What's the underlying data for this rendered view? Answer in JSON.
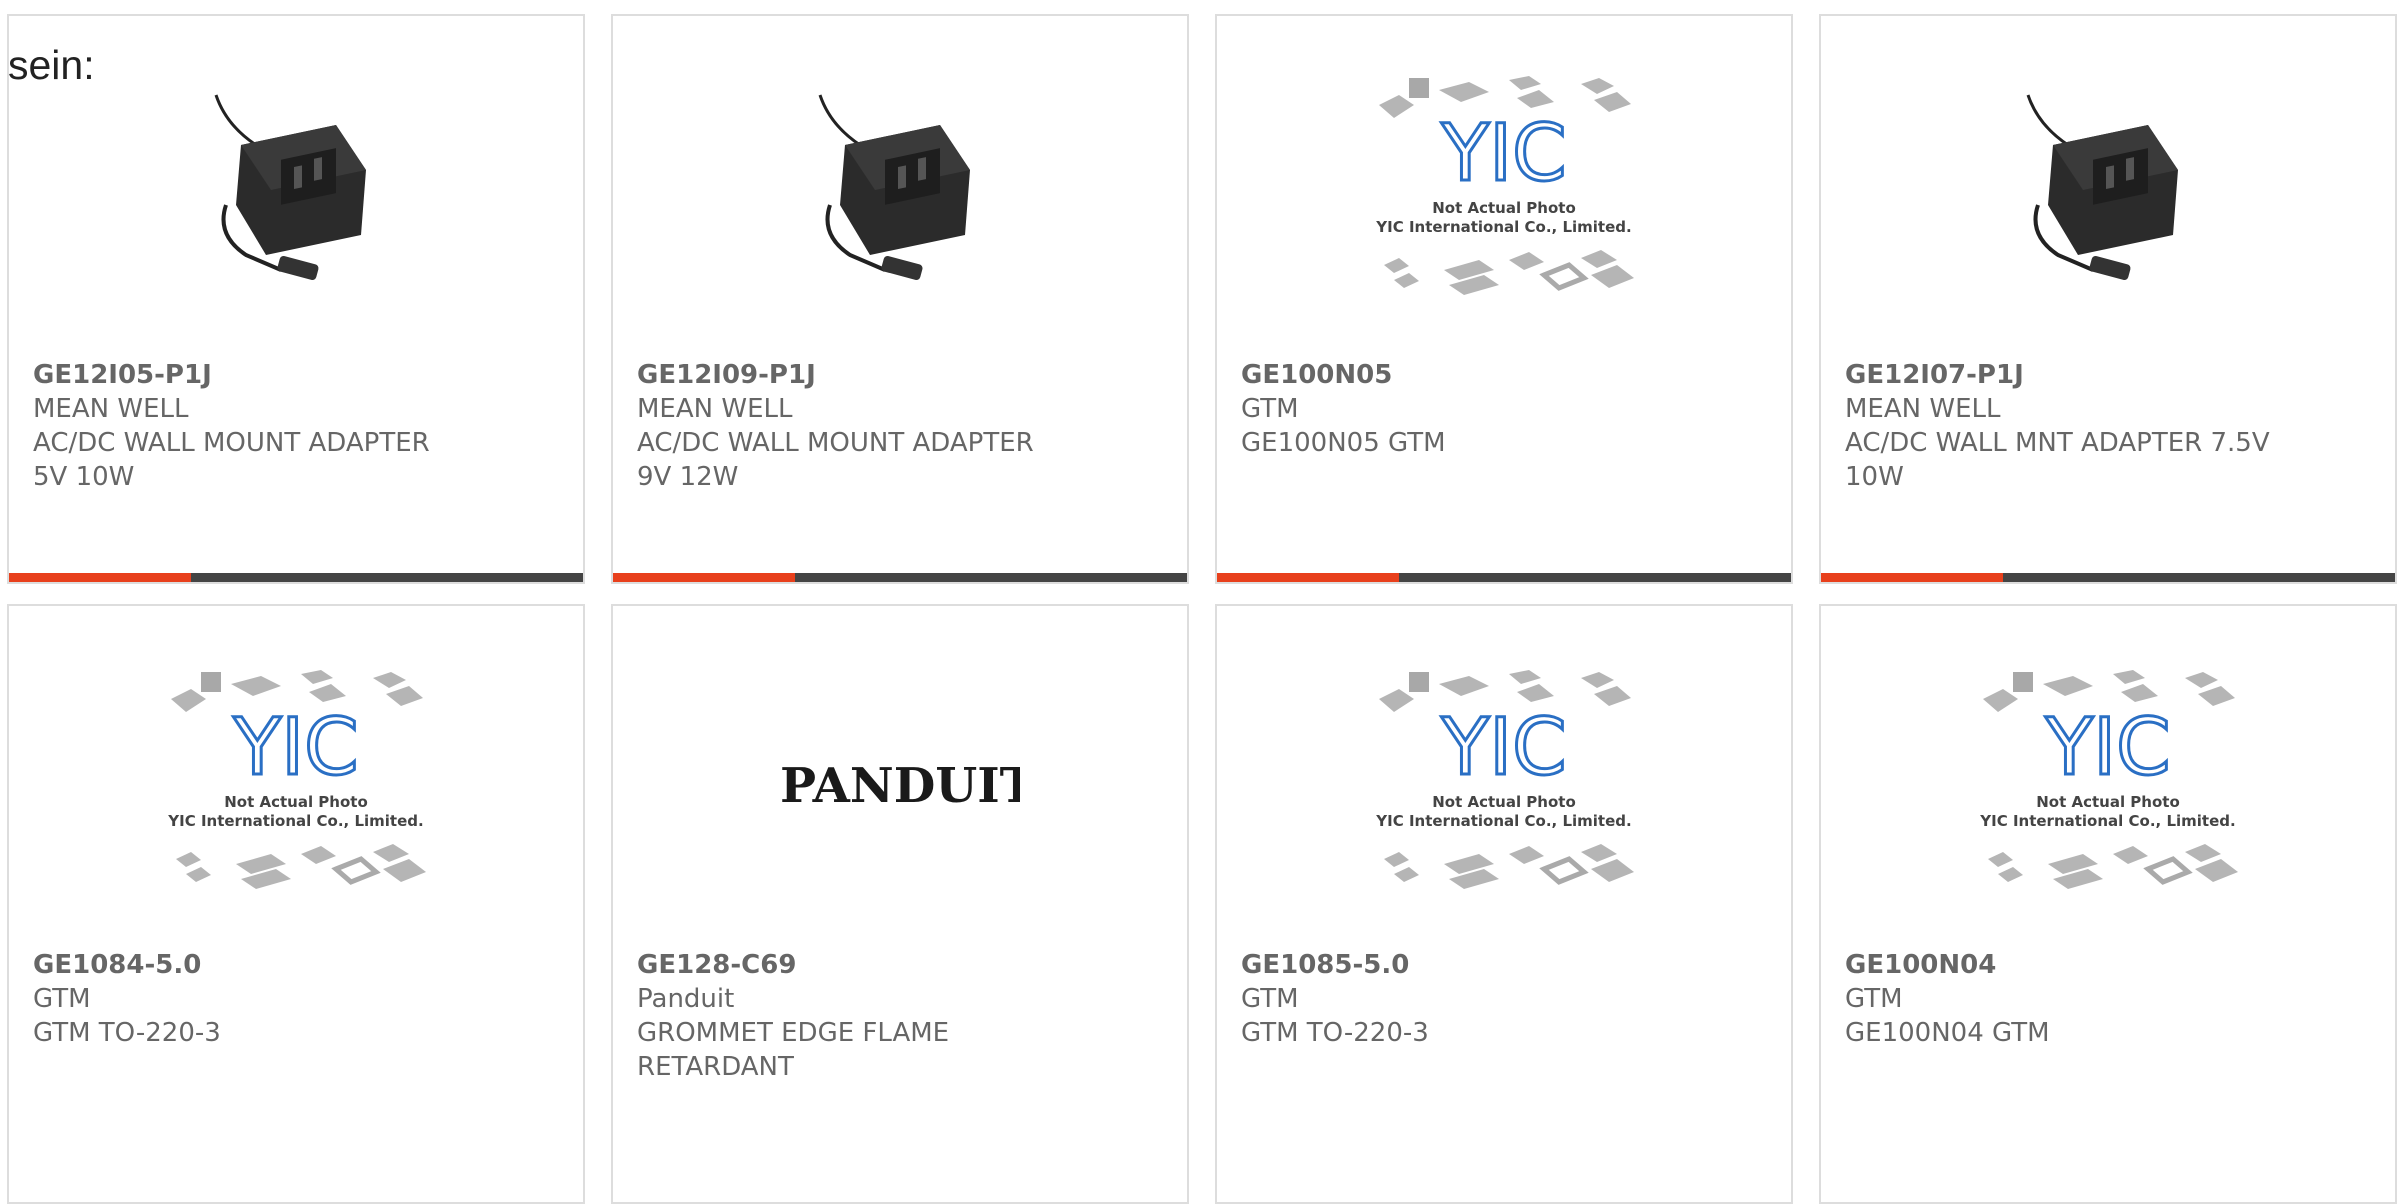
{
  "intro_text": "sein:",
  "accent_color": "#e8401c",
  "products": [
    {
      "part": "GE12I05-P1J",
      "maker": "MEAN WELL",
      "desc1": "AC/DC WALL MOUNT ADAPTER",
      "desc2": "5V 10W",
      "image": "adapter-photo-icon"
    },
    {
      "part": "GE12I09-P1J",
      "maker": "MEAN WELL",
      "desc1": "AC/DC WALL MOUNT ADAPTER",
      "desc2": "9V 12W",
      "image": "adapter-photo-icon"
    },
    {
      "part": "GE100N05",
      "maker": "GTM",
      "desc1": "GE100N05 GTM",
      "desc2": "",
      "image": "placeholder-photo-icon"
    },
    {
      "part": "GE12I07-P1J",
      "maker": "MEAN WELL",
      "desc1": "AC/DC WALL MNT ADAPTER 7.5V",
      "desc2": "10W",
      "image": "adapter-photo-icon"
    },
    {
      "part": "GE1084-5.0",
      "maker": "GTM",
      "desc1": "GTM TO-220-3",
      "desc2": "",
      "image": "placeholder-photo-icon"
    },
    {
      "part": "GE128-C69",
      "maker": "Panduit",
      "desc1": "GROMMET EDGE FLAME",
      "desc2": "RETARDANT",
      "image": "panduit-logo-icon"
    },
    {
      "part": "GE1085-5.0",
      "maker": "GTM",
      "desc1": "GTM TO-220-3",
      "desc2": "",
      "image": "placeholder-photo-icon"
    },
    {
      "part": "GE100N04",
      "maker": "GTM",
      "desc1": "GE100N04 GTM",
      "desc2": "",
      "image": "placeholder-photo-icon"
    }
  ],
  "placeholder": {
    "line1": "Not Actual Photo",
    "line2": "YIC International Co., Limited.",
    "logo": "YIC"
  },
  "panduit_logo_text": "PANDUIT"
}
